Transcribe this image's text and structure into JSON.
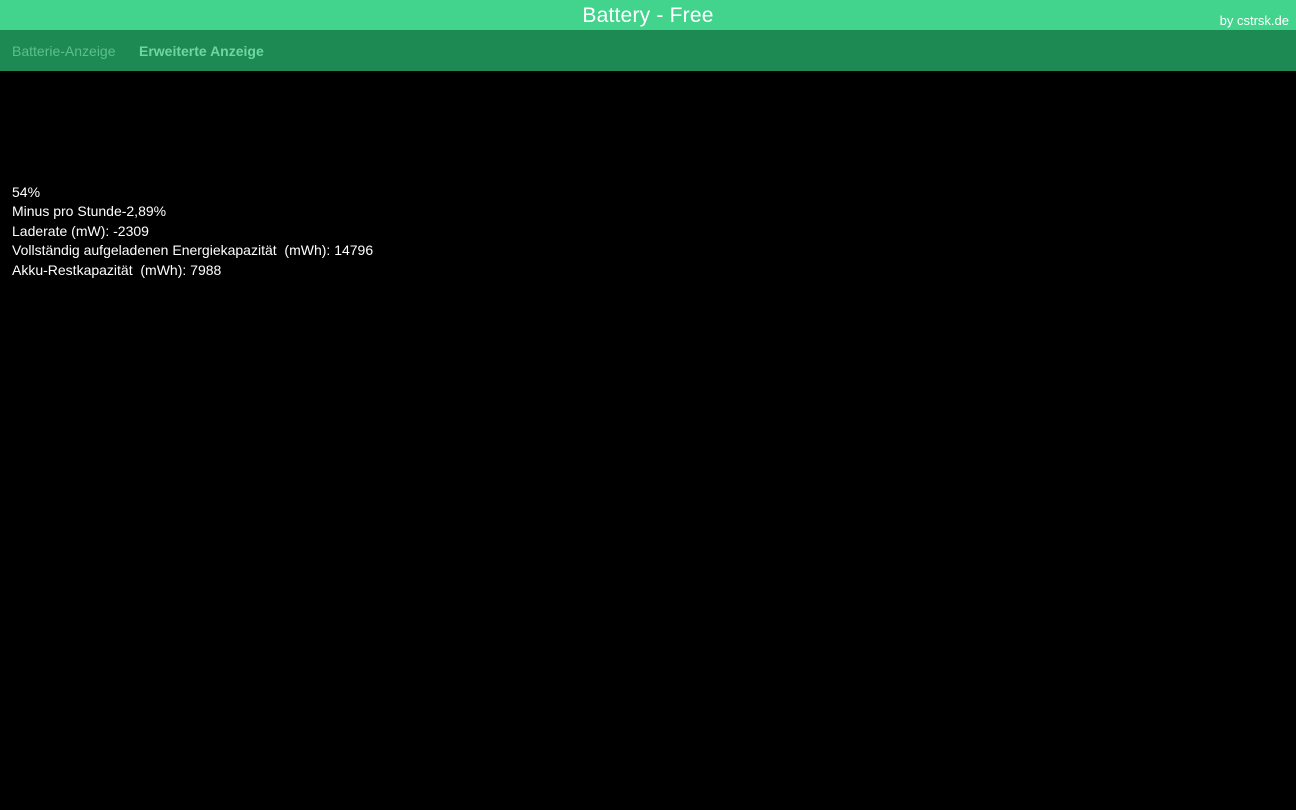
{
  "header": {
    "title": "Battery - Free",
    "byline": "by cstrsk.de",
    "accent_color": "#42d38c"
  },
  "tabs": [
    {
      "label": "Batterie-Anzeige",
      "selected": false
    },
    {
      "label": "Erweiterte Anzeige",
      "selected": true
    }
  ],
  "tabbar": {
    "color": "#1e8a53"
  },
  "battery": {
    "percent": "54%",
    "minus_per_hour": "Minus pro Stunde-2,89%",
    "charge_rate": "Laderate (mW): -2309",
    "full_capacity": "Vollständig aufgeladenen Energiekapazität  (mWh): 14796",
    "remaining_capacity": "Akku-Restkapazität  (mWh): 7988"
  }
}
